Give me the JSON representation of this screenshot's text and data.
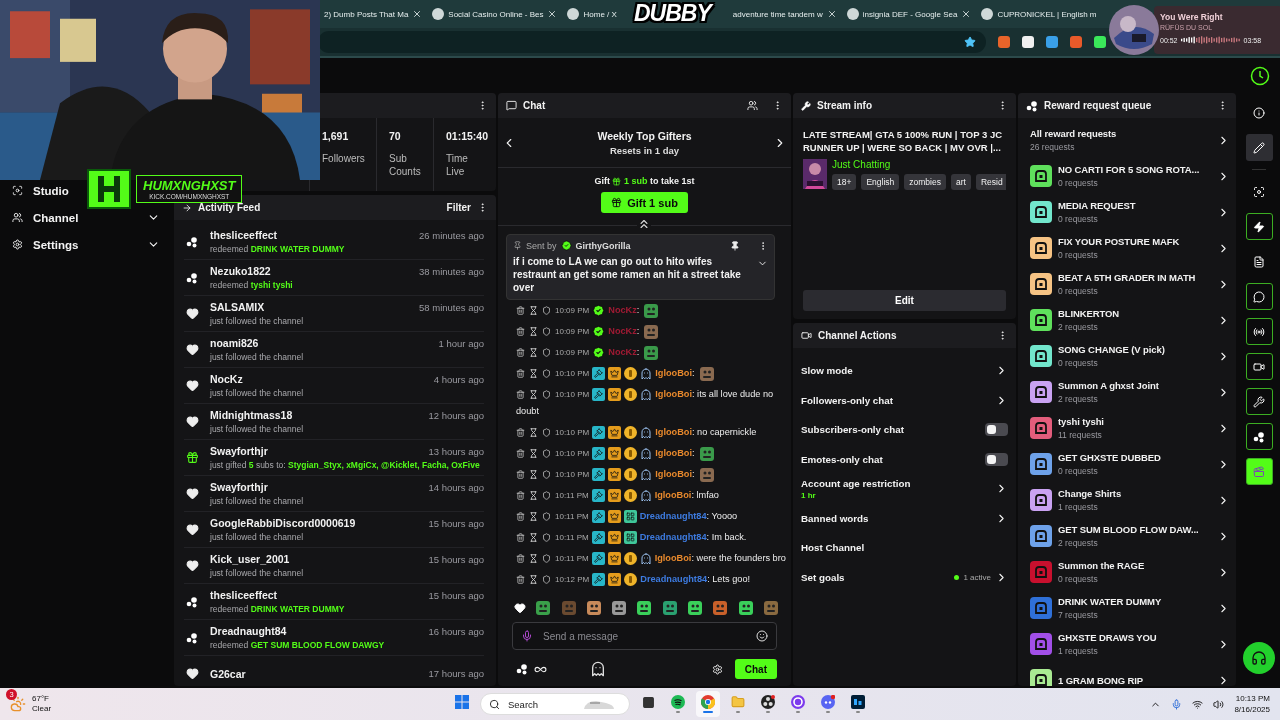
{
  "browser": {
    "tabs": [
      {
        "title": "2) Dumb Posts That Ma",
        "icon": false,
        "closable": true
      },
      {
        "title": "Social Casino Online - Bes",
        "icon": true,
        "closable": true
      },
      {
        "title": "Home / X",
        "icon": true,
        "closable": false
      },
      {
        "title": "adventure time tandem w",
        "icon": false,
        "closable": true
      },
      {
        "title": "insignia DEF - Google Sea",
        "icon": true,
        "closable": true
      },
      {
        "title": "CUPRONICKEL | English m",
        "icon": true,
        "closable": false
      }
    ],
    "overlay_title": "DUBBY",
    "music": {
      "title": "You Were Right",
      "artist": "RÜFÜS DU SOL",
      "elapsed": "00:52",
      "duration": "03:58",
      "level": 0.22
    }
  },
  "stream_logo": {
    "name": "HUMXNGHXST",
    "url": "KICK.COM/HUMXNGHXST"
  },
  "sidebar": {
    "items": [
      {
        "label": "Studio",
        "kind": "studio",
        "expandable": false
      },
      {
        "label": "Channel",
        "kind": "channel",
        "expandable": true
      },
      {
        "label": "Settings",
        "kind": "settings",
        "expandable": true
      }
    ]
  },
  "stats": [
    {
      "value": "1,691",
      "label": "Followers"
    },
    {
      "value": "70",
      "label": "Sub Counts"
    },
    {
      "value": "01:15:40",
      "label": "Time Live"
    }
  ],
  "activity_feed": {
    "title": "Activity Feed",
    "filter": "Filter",
    "items": [
      {
        "kind": "redeem",
        "name": "thesliceeffect",
        "time": "26 minutes ago",
        "segments": [
          {
            "text": "redeemed",
            "accent": false
          },
          {
            "text": "DRINK WATER DUMMY",
            "accent": true
          }
        ]
      },
      {
        "kind": "redeem",
        "name": "Nezuko1822",
        "time": "38 minutes ago",
        "segments": [
          {
            "text": "redeemed",
            "accent": false
          },
          {
            "text": "tyshi tyshi",
            "accent": true
          }
        ]
      },
      {
        "kind": "follow",
        "name": "SALSAMIX",
        "time": "58 minutes ago",
        "segments": [
          {
            "text": "just followed the channel",
            "accent": false
          }
        ]
      },
      {
        "kind": "follow",
        "name": "noami826",
        "time": "1 hour ago",
        "segments": [
          {
            "text": "just followed the channel",
            "accent": false
          }
        ]
      },
      {
        "kind": "follow",
        "name": "NocKz",
        "time": "4 hours ago",
        "segments": [
          {
            "text": "just followed the channel",
            "accent": false
          }
        ]
      },
      {
        "kind": "follow",
        "name": "Midnightmass18",
        "time": "12 hours ago",
        "segments": [
          {
            "text": "just followed the channel",
            "accent": false
          }
        ]
      },
      {
        "kind": "gift",
        "name": "Swayforthjr",
        "time": "13 hours ago",
        "segments": [
          {
            "text": "just gifted",
            "accent": false
          },
          {
            "text": "5",
            "accent": true
          },
          {
            "text": "subs to:",
            "accent": false
          },
          {
            "text": "Stygian_Styx, xMgiCx, @Kicklet, Facha, OxFive",
            "accent": true
          }
        ]
      },
      {
        "kind": "follow",
        "name": "Swayforthjr",
        "time": "14 hours ago",
        "segments": [
          {
            "text": "just followed the channel",
            "accent": false
          }
        ]
      },
      {
        "kind": "follow",
        "name": "GoogleRabbiDiscord0000619",
        "time": "15 hours ago",
        "segments": [
          {
            "text": "just followed the channel",
            "accent": false
          }
        ]
      },
      {
        "kind": "follow",
        "name": "Kick_user_2001",
        "time": "15 hours ago",
        "segments": [
          {
            "text": "just followed the channel",
            "accent": false
          }
        ]
      },
      {
        "kind": "redeem",
        "name": "thesliceeffect",
        "time": "15 hours ago",
        "segments": [
          {
            "text": "redeemed",
            "accent": false
          },
          {
            "text": "DRINK WATER DUMMY",
            "accent": true
          }
        ]
      },
      {
        "kind": "redeem",
        "name": "Dreadnaught84",
        "time": "16 hours ago",
        "segments": [
          {
            "text": "redeemed",
            "accent": false
          },
          {
            "text": "GET SUM BLOOD FLOW DAWGY",
            "accent": true
          }
        ]
      },
      {
        "kind": "follow",
        "name": "G26car",
        "time": "17 hours ago"
      }
    ]
  },
  "chat": {
    "title": "Chat",
    "gifters": {
      "title": "Weekly Top Gifters",
      "subtitle": "Resets in 1 day"
    },
    "gift_prompt": {
      "before": "Gift",
      "amount": "1 sub",
      "after": "to take 1st",
      "button": "Gift 1 sub"
    },
    "pinned": {
      "label": "Sent by",
      "user": "GirthyGorilla",
      "text": "if i come to LA we can go out to hito wifes restraunt an get some ramen an hit a street take over"
    },
    "messages": [
      {
        "time": "10:09 PM",
        "kind": "verified",
        "user": "NocKz",
        "color": "#a01a33",
        "text": ":",
        "emote": true
      },
      {
        "time": "10:09 PM",
        "kind": "verified",
        "user": "NocKz",
        "color": "#a01a33",
        "text": ":",
        "emote": true
      },
      {
        "time": "10:09 PM",
        "kind": "verified",
        "user": "NocKz",
        "color": "#a01a33",
        "text": ":",
        "emote": true
      },
      {
        "time": "10:10 PM",
        "kind": "ghost",
        "user": "IglooBoi",
        "color": "#e8892c",
        "text": ":",
        "emote": true
      },
      {
        "time": "10:10 PM",
        "kind": "ghost",
        "user": "IglooBoi",
        "color": "#e8892c",
        "text": ": its all love dude no doubt",
        "emote": false
      },
      {
        "time": "10:10 PM",
        "kind": "ghost",
        "user": "IglooBoi",
        "color": "#e8892c",
        "text": ": no capernickle",
        "emote": false
      },
      {
        "time": "10:10 PM",
        "kind": "ghost",
        "user": "IglooBoi",
        "color": "#e8892c",
        "text": ":",
        "emote": true
      },
      {
        "time": "10:10 PM",
        "kind": "ghost",
        "user": "IglooBoi",
        "color": "#e8892c",
        "text": ":",
        "emote": true
      },
      {
        "time": "10:11 PM",
        "kind": "ghost",
        "user": "IglooBoi",
        "color": "#e8892c",
        "text": ": lmfao",
        "emote": false
      },
      {
        "time": "10:11 PM",
        "kind": "team",
        "user": "Dreadnaught84",
        "color": "#3d7be0",
        "text": ": Yoooo",
        "emote": false
      },
      {
        "time": "10:11 PM",
        "kind": "team",
        "user": "Dreadnaught84",
        "color": "#3d7be0",
        "text": ": Im back.",
        "emote": false
      },
      {
        "time": "10:11 PM",
        "kind": "ghost",
        "user": "IglooBoi",
        "color": "#e8892c",
        "text": ": were the founders bro",
        "emote": false
      },
      {
        "time": "10:12 PM",
        "kind": "coin",
        "user": "Dreadnaught84",
        "color": "#3d7be0",
        "text": ": Lets goo!",
        "emote": false
      }
    ],
    "emote_bar": [
      {
        "kind": "heart"
      },
      {
        "kind": "emote"
      },
      {
        "kind": "emote"
      },
      {
        "kind": "emote"
      },
      {
        "kind": "emote"
      },
      {
        "kind": "emote"
      },
      {
        "kind": "emote"
      },
      {
        "kind": "emote"
      },
      {
        "kind": "emote"
      },
      {
        "kind": "emote"
      },
      {
        "kind": "emote"
      }
    ],
    "input": {
      "placeholder": "Send a message"
    },
    "send": "Chat"
  },
  "stream_info": {
    "title": "Stream info",
    "stream_title": "LATE STREAM| GTA 5 100% RUN | TOP 3 JC RUNNER UP | WERE SO BACK | MV OVR |...",
    "category": "Just Chatting",
    "tags": [
      "18+",
      "English",
      "zombies",
      "art",
      "Resid"
    ],
    "edit": "Edit"
  },
  "channel_actions": {
    "title": "Channel Actions",
    "rows": [
      {
        "label": "Slow mode",
        "kind": "link"
      },
      {
        "label": "Followers-only chat",
        "kind": "link"
      },
      {
        "label": "Subscribers-only chat",
        "kind": "toggle",
        "on": false
      },
      {
        "label": "Emotes-only chat",
        "kind": "toggle",
        "on": false
      },
      {
        "label": "Account age restriction",
        "kind": "link",
        "detail": "1 hr"
      },
      {
        "label": "Banned words",
        "kind": "link"
      },
      {
        "label": "Host Channel",
        "kind": "plain"
      },
      {
        "label": "Set goals",
        "kind": "link",
        "status": "1 active"
      }
    ]
  },
  "reward_queue": {
    "title": "Reward request queue",
    "all": {
      "label": "All reward requests",
      "count": "26 requests"
    },
    "items": [
      {
        "name": "NO CARTI FOR 5 SONG ROTA...",
        "count": "0 requests",
        "color": "#5fe05c"
      },
      {
        "name": "MEDIA REQUEST",
        "count": "0 requests",
        "color": "#72e6cc"
      },
      {
        "name": "FIX YOUR POSTURE MAFK",
        "count": "0 requests",
        "color": "#f6c384"
      },
      {
        "name": "BEAT A 5TH GRADER IN MATH",
        "count": "0 requests",
        "color": "#f6c384"
      },
      {
        "name": "BLINKERTON",
        "count": "2 requests",
        "color": "#5fe05c"
      },
      {
        "name": "SONG CHANGE (V pick)",
        "count": "0 requests",
        "color": "#72e6cc"
      },
      {
        "name": "Summon A ghxst Joint",
        "count": "2 requests",
        "color": "#c9a2f2"
      },
      {
        "name": "tyshi tyshi",
        "count": "11 requests",
        "color": "#e35d7c"
      },
      {
        "name": "GET GHXSTE DUBBED",
        "count": "0 requests",
        "color": "#6ea2ea"
      },
      {
        "name": "Change Shirts",
        "count": "1 requests",
        "color": "#c9a2f2"
      },
      {
        "name": "GET SUM BLOOD FLOW DAW...",
        "count": "2 requests",
        "color": "#6ea2ea"
      },
      {
        "name": "Summon the RAGE",
        "count": "0 requests",
        "color": "#c8102e"
      },
      {
        "name": "DRINK WATER DUMMY",
        "count": "7 requests",
        "color": "#2f70d8"
      },
      {
        "name": "GHXSTE DRAWS YOU",
        "count": "1 requests",
        "color": "#a24fe8"
      },
      {
        "name": "1 GRAM BONG RIP",
        "color": "#a9ea92"
      }
    ]
  },
  "rail": [
    {
      "kind": "info",
      "selected": false,
      "on": false
    },
    {
      "kind": "pencil",
      "selected": true,
      "on": false
    },
    {
      "kind": "divider"
    },
    {
      "kind": "screen",
      "selected": false,
      "on": false
    },
    {
      "kind": "bolt",
      "selected": false,
      "on": true
    },
    {
      "kind": "document",
      "selected": false,
      "on": false
    },
    {
      "kind": "chat",
      "selected": false,
      "on": true
    },
    {
      "kind": "broadcast",
      "selected": false,
      "on": true
    },
    {
      "kind": "camera",
      "selected": false,
      "on": true
    },
    {
      "kind": "wrench",
      "selected": false,
      "on": true
    },
    {
      "kind": "dots",
      "selected": false,
      "on": true
    },
    {
      "kind": "clapper",
      "selected": false,
      "on": true
    }
  ],
  "taskbar": {
    "weather": {
      "temp": "67°F",
      "condition": "Clear",
      "badge": "3"
    },
    "search": {
      "placeholder": "Search"
    },
    "apps": [
      {
        "kind": "start",
        "running": false,
        "selected": false
      },
      {
        "kind": "search"
      },
      {
        "kind": "taskview",
        "running": false,
        "selected": false
      },
      {
        "kind": "spotify",
        "running": true,
        "selected": false
      },
      {
        "kind": "chrome",
        "running": true,
        "selected": true
      },
      {
        "kind": "folder",
        "running": true,
        "selected": false
      },
      {
        "kind": "obs",
        "running": true,
        "selected": false
      },
      {
        "kind": "ring",
        "running": true,
        "selected": false
      },
      {
        "kind": "discord",
        "running": true,
        "selected": false
      },
      {
        "kind": "ps",
        "running": true,
        "selected": false
      }
    ],
    "time": "10:13 PM",
    "date": "8/16/2025"
  }
}
